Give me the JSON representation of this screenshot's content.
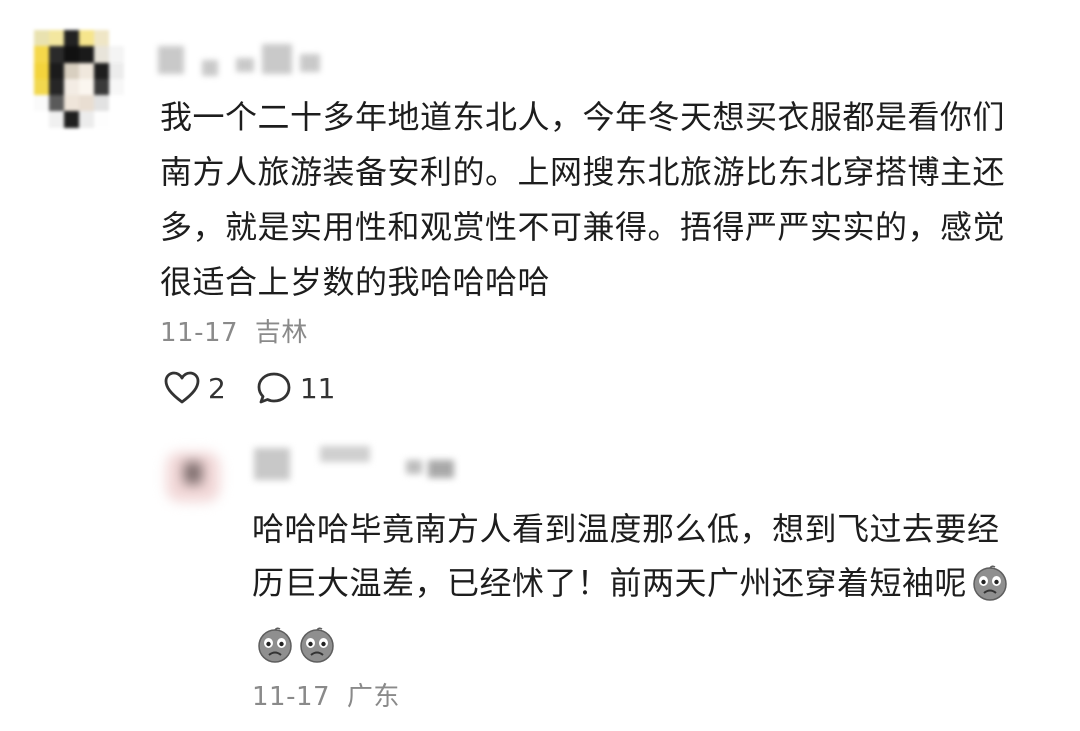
{
  "comment": {
    "text": "我一个二十多年地道东北人，今年冬天想买衣服都是看你们南方人旅游装备安利的。上网搜东北旅游比东北穿搭博主还多，就是实用性和观赏性不可兼得。捂得严严实实的，感觉很适合上岁数的我哈哈哈哈",
    "date": "11-17",
    "location": "吉林",
    "likes": "2",
    "replies": "11"
  },
  "reply": {
    "text": "哈哈哈毕竟南方人看到温度那么低，想到飞过去要经历巨大温差，已经怵了！前两天广州还穿着短袖呢",
    "date": "11-17",
    "location": "广东",
    "emoji_count": 3,
    "emoji_icon": "crying-face-emoji"
  }
}
